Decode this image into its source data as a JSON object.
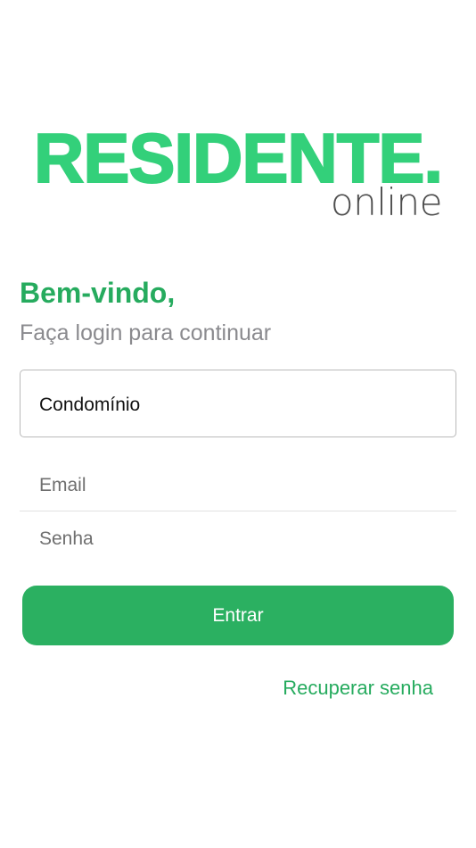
{
  "logo": {
    "main_text": "RESIDENTE.",
    "sub_text": "online"
  },
  "header": {
    "welcome": "Bem-vindo,",
    "subtitle": "Faça login para continuar"
  },
  "form": {
    "condominio_value": "Condomínio",
    "email_placeholder": "Email",
    "senha_placeholder": "Senha",
    "submit_label": "Entrar",
    "recover_label": "Recuperar senha"
  },
  "colors": {
    "brand_green": "#33d07a",
    "button_green": "#2bb061",
    "heading_green": "#26ab5e",
    "subtitle_gray": "#8a8a8e",
    "logo_sub_gray": "#4d4d4d"
  }
}
